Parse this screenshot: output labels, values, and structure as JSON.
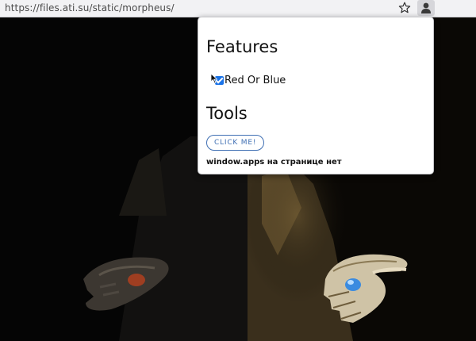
{
  "browser": {
    "url": "https://files.ati.su/static/morpheus/",
    "bookmark_icon": "star-icon",
    "extension_icon": "person-icon"
  },
  "popup": {
    "features_heading": "Features",
    "feature_item": {
      "label": "Red Or Blue",
      "checked": true
    },
    "tools_heading": "Tools",
    "click_button": "CLICK ME!",
    "status_text": "window.apps на странице нет"
  },
  "colors": {
    "checkbox_accent": "#1a73e8",
    "button_accent": "#3f6fb3",
    "blue_pill": "#3a8be0",
    "red_pill": "#b0401e"
  }
}
